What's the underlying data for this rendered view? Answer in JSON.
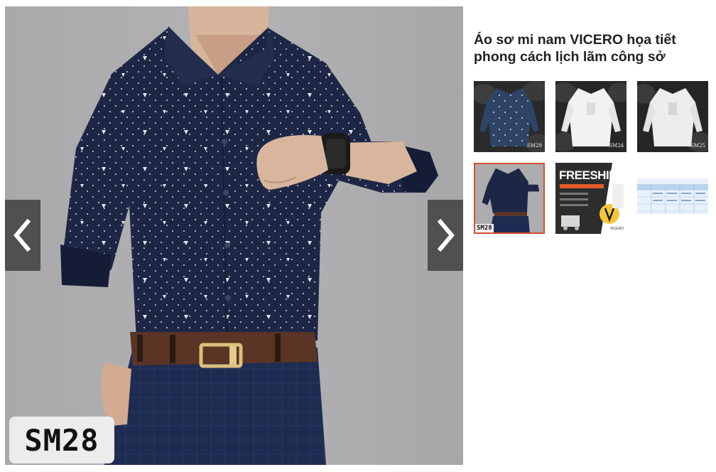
{
  "product": {
    "title": "Áo sơ mi nam VICERO họa tiết phong cách lịch lãm công sở",
    "code_badge": "SM28"
  },
  "viewer": {
    "prev_icon": "chevron-left-icon",
    "next_icon": "chevron-right-icon"
  },
  "thumbnails": [
    {
      "code": "SM29",
      "shirt_color": "#2e4466"
    },
    {
      "code": "SM24",
      "shirt_color": "#f2f2f2"
    },
    {
      "code": "SM25",
      "shirt_color": "#ededed"
    },
    {
      "code": "SM28",
      "shirt_color": "#1d2745",
      "selected": true
    },
    {
      "code": "FREESHIP",
      "brand": "VICERO"
    },
    {
      "type": "size-table"
    }
  ],
  "colors": {
    "accent_border": "#d2512e",
    "shirt_navy": "#1d2745",
    "pants_navy": "#1f2c52",
    "belt_brown": "#5a3424"
  }
}
